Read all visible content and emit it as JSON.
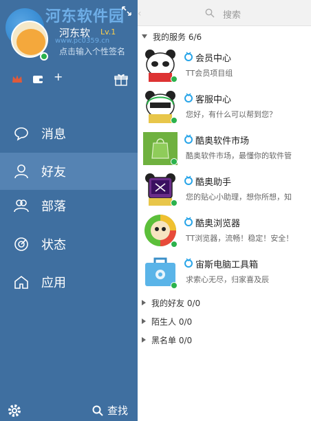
{
  "watermark": {
    "text": "河东软件园",
    "url": "www.pc0359.cn"
  },
  "profile": {
    "nickname": "河东软",
    "level": "Lv.1",
    "signature": "点击输入个性签名"
  },
  "nav": [
    {
      "label": "消息",
      "icon": "message-icon"
    },
    {
      "label": "好友",
      "icon": "friend-icon",
      "active": true
    },
    {
      "label": "部落",
      "icon": "tribe-icon"
    },
    {
      "label": "状态",
      "icon": "status-icon"
    },
    {
      "label": "应用",
      "icon": "app-icon"
    }
  ],
  "bottom": {
    "find_label": "查找"
  },
  "search": {
    "placeholder": "搜索"
  },
  "groups": {
    "services": {
      "label": "我的服务 6/6"
    },
    "friends": {
      "label": "我的好友 0/0"
    },
    "strangers": {
      "label": "陌生人 0/0"
    },
    "blacklist": {
      "label": "黑名单 0/0"
    }
  },
  "services": [
    {
      "name": "会员中心",
      "desc": "TT会员项目组",
      "icon": "panda-member-icon"
    },
    {
      "name": "客服中心",
      "desc": "您好，有什么可以帮到您？",
      "icon": "panda-support-icon"
    },
    {
      "name": "酷奥软件市场",
      "desc": "酷奥软件市场，最懂你的软件管",
      "icon": "market-icon"
    },
    {
      "name": "酷奥助手",
      "desc": "您的贴心小助理，想你所想，知",
      "icon": "panda-assistant-icon"
    },
    {
      "name": "酷奥浏览器",
      "desc": "TT浏览器，流畅！稳定！安全！",
      "icon": "browser-icon"
    },
    {
      "name": "宙斯电脑工具箱",
      "desc": "求索心无尽，归家喜及辰",
      "icon": "toolbox-icon"
    }
  ],
  "colors": {
    "sidebar": "#3f6fa0",
    "sidebar_active": "#5583b3",
    "online": "#2bb24c",
    "level": "#ffd24a"
  }
}
